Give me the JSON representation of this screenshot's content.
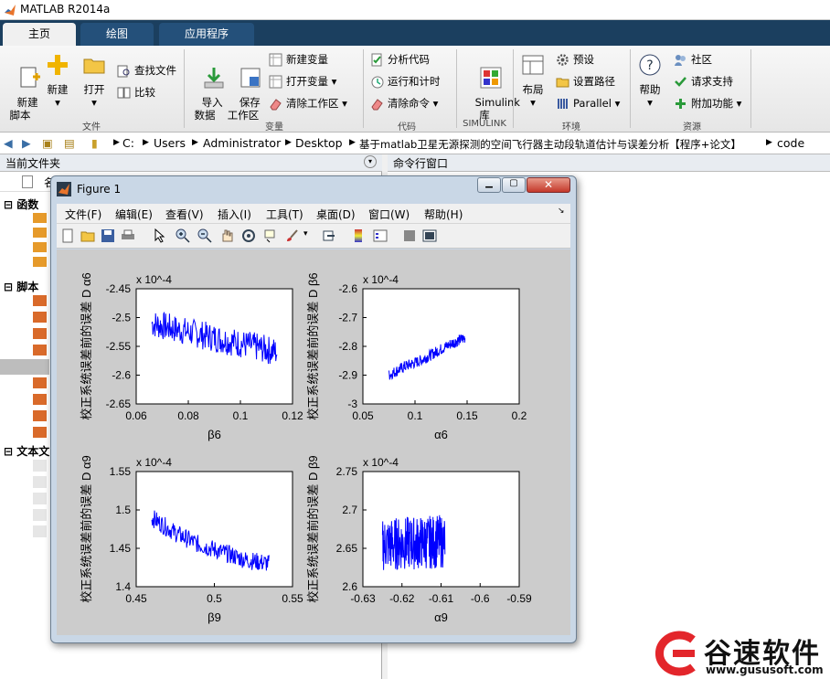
{
  "window": {
    "title": "MATLAB R2014a"
  },
  "tabs": [
    {
      "label": "主页"
    },
    {
      "label": "绘图"
    },
    {
      "label": "应用程序"
    }
  ],
  "ribbon": {
    "file": {
      "new_script": "新建\n脚本",
      "new": "新建",
      "open": "打开",
      "find_files": "查找文件",
      "compare": "比较",
      "group": "文件"
    },
    "variable": {
      "import": "导入\n数据",
      "save_ws": "保存\n工作区",
      "new_var": "新建变量",
      "open_var": "打开变量",
      "clear_ws": "清除工作区",
      "group": "变量"
    },
    "code": {
      "analyze": "分析代码",
      "run_time": "运行和计时",
      "clear_cmd": "清除命令",
      "group": "代码"
    },
    "simulink": {
      "lib": "Simulink\n库",
      "group": "SIMULINK"
    },
    "env": {
      "layout": "布局",
      "prefs": "预设",
      "set_path": "设置路径",
      "parallel": "Parallel",
      "group": "环境"
    },
    "resources": {
      "help": "帮助",
      "community": "社区",
      "support": "请求支持",
      "addons": "附加功能",
      "group": "资源"
    }
  },
  "path": [
    "C:",
    "Users",
    "Administrator",
    "Desktop",
    "基于matlab卫星无源探测的空间飞行器主动段轨道估计与误差分析【程序+论文】",
    "code"
  ],
  "left_panel": {
    "title": "当前文件夹",
    "col_name": "名",
    "sections": [
      {
        "label": "函数"
      },
      {
        "label": "脚本"
      },
      {
        "label": "文本文"
      }
    ]
  },
  "right_panel": {
    "title": "命令行窗口"
  },
  "figure": {
    "title": "Figure 1",
    "menu": [
      "文件(F)",
      "编辑(E)",
      "查看(V)",
      "插入(I)",
      "工具(T)",
      "桌面(D)",
      "窗口(W)",
      "帮助(H)"
    ]
  },
  "chart_data": [
    {
      "type": "line",
      "ylabel": "校正系统误差前的误差 D α6",
      "xlabel": "β6",
      "exponent": "x 10^-4",
      "xlim": [
        0.06,
        0.12
      ],
      "ylim": [
        -2.65,
        -2.45
      ],
      "xticks": [
        "0.06",
        "0.08",
        "0.1",
        "0.12"
      ],
      "yticks": [
        "-2.45",
        "-2.5",
        "-2.55",
        "-2.6",
        "-2.65"
      ],
      "series": [
        {
          "x": [
            0.066,
            0.075,
            0.085,
            0.095,
            0.105,
            0.114
          ],
          "y": [
            -2.51,
            -2.52,
            -2.53,
            -2.54,
            -2.55,
            -2.56
          ]
        }
      ],
      "noise": 0.025
    },
    {
      "type": "line",
      "ylabel": "校正系统误差前的误差 D β6",
      "xlabel": "α6",
      "exponent": "x 10^-4",
      "xlim": [
        0.05,
        0.2
      ],
      "ylim": [
        -3,
        -2.6
      ],
      "xticks": [
        "0.05",
        "0.1",
        "0.15",
        "0.2"
      ],
      "yticks": [
        "-2.6",
        "-2.7",
        "-2.8",
        "-2.9",
        "-3"
      ],
      "series": [
        {
          "x": [
            0.075,
            0.09,
            0.105,
            0.12,
            0.135,
            0.148
          ],
          "y": [
            -2.9,
            -2.87,
            -2.85,
            -2.82,
            -2.79,
            -2.77
          ]
        }
      ],
      "noise": 0.02
    },
    {
      "type": "line",
      "ylabel": "校正系统误差前的误差 D α9",
      "xlabel": "β9",
      "exponent": "x 10^-4",
      "xlim": [
        0.45,
        0.55
      ],
      "ylim": [
        1.4,
        1.55
      ],
      "xticks": [
        "0.45",
        "0.5",
        "0.55"
      ],
      "yticks": [
        "1.55",
        "1.5",
        "1.45",
        "1.4"
      ],
      "series": [
        {
          "x": [
            0.46,
            0.475,
            0.49,
            0.505,
            0.52,
            0.535
          ],
          "y": [
            1.49,
            1.47,
            1.455,
            1.445,
            1.435,
            1.43
          ]
        }
      ],
      "noise": 0.012
    },
    {
      "type": "line",
      "ylabel": "校正系统误差前的误差 D β9",
      "xlabel": "α9",
      "exponent": "x 10^-4",
      "xlim": [
        -0.63,
        -0.59
      ],
      "ylim": [
        2.6,
        2.75
      ],
      "xticks": [
        "-0.63",
        "-0.62",
        "-0.61",
        "-0.6",
        "-0.59"
      ],
      "yticks": [
        "2.75",
        "2.7",
        "2.65",
        "2.6"
      ],
      "series": [
        {
          "x": [
            -0.625,
            -0.621,
            -0.617,
            -0.613,
            -0.609
          ],
          "y": [
            2.655,
            2.656,
            2.657,
            2.658,
            2.659
          ]
        }
      ],
      "noise": 0.035
    }
  ],
  "watermark": {
    "brand": "谷速软件",
    "url": "www.gususoft.com"
  },
  "colors": {
    "accent": "#1b3f5f",
    "line": "#0000ff",
    "watermark": "#e3262b"
  }
}
